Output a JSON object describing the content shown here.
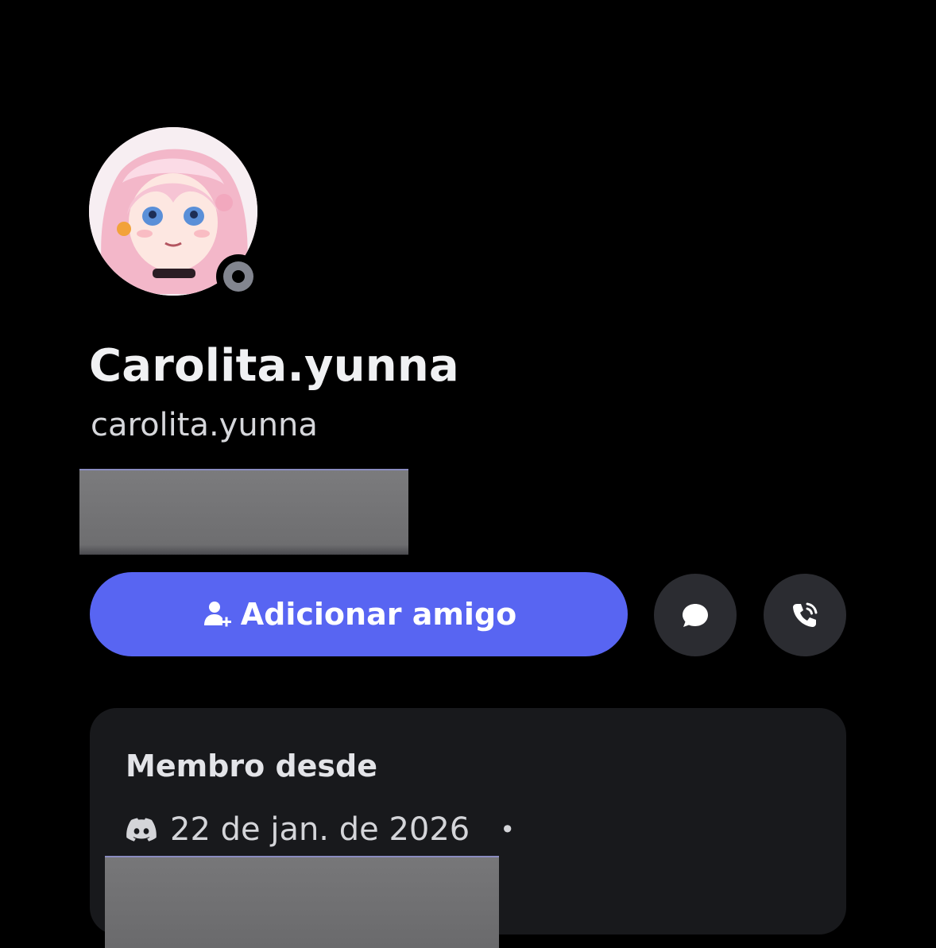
{
  "profile": {
    "display_name": "Carolita.yunna",
    "username": "carolita.yunna",
    "status": "offline"
  },
  "actions": {
    "add_friend_label": "Adicionar amigo",
    "add_friend_icon": "add-user-icon",
    "message_icon": "chat-bubble-icon",
    "call_icon": "phone-call-icon"
  },
  "member_since": {
    "title": "Membro desde",
    "icon": "discord-icon",
    "date": "22 de jan. de 2026",
    "separator": "•"
  },
  "colors": {
    "background": "#000000",
    "accent": "#5865f2",
    "card": "#18191c",
    "round_button": "#2b2c31",
    "status_offline": "#82858f"
  }
}
